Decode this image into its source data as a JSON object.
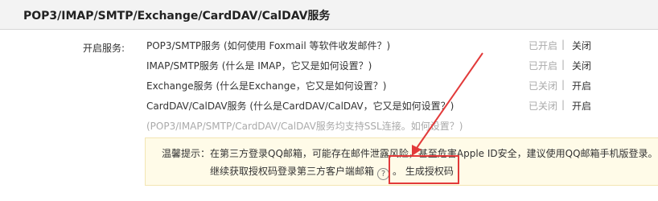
{
  "header": {
    "title": "POP3/IMAP/SMTP/Exchange/CardDAV/CalDAV服务"
  },
  "services": {
    "label": "开启服务:",
    "items": [
      {
        "name": "POP3/SMTP服务",
        "hint": "(如何使用 Foxmail 等软件收发邮件？)",
        "state": "已开启",
        "separator": "|",
        "action": "关闭"
      },
      {
        "name": "IMAP/SMTP服务",
        "hint": "(什么是 IMAP，它又是如何设置？)",
        "state": "已开启",
        "separator": "|",
        "action": "关闭"
      },
      {
        "name": "Exchange服务",
        "hint": "(什么是Exchange，它又是如何设置？)",
        "state": "已关闭",
        "separator": "|",
        "action": "开启"
      },
      {
        "name": "CardDAV/CalDAV服务",
        "hint": "(什么是CardDAV/CalDAV，它又是如何设置？)",
        "state": "已关闭",
        "separator": "|",
        "action": "开启"
      }
    ],
    "ssl_note": "(POP3/IMAP/SMTP/CardDAV/CalDAV服务均支持SSL连接。如何设置？)"
  },
  "warning": {
    "line1": "温馨提示：在第三方登录QQ邮箱，可能存在邮件泄露风险，甚至危害Apple ID安全，建议使用QQ邮箱手机版登录。",
    "line2": "继续获取授权码登录第三方客户端邮箱",
    "help_icon": "?",
    "period": "。",
    "generate_link": "生成授权码"
  },
  "colors": {
    "highlight": "#e23a3a",
    "muted": "#aaaaaa",
    "warning_bg": "#fffbe8"
  }
}
